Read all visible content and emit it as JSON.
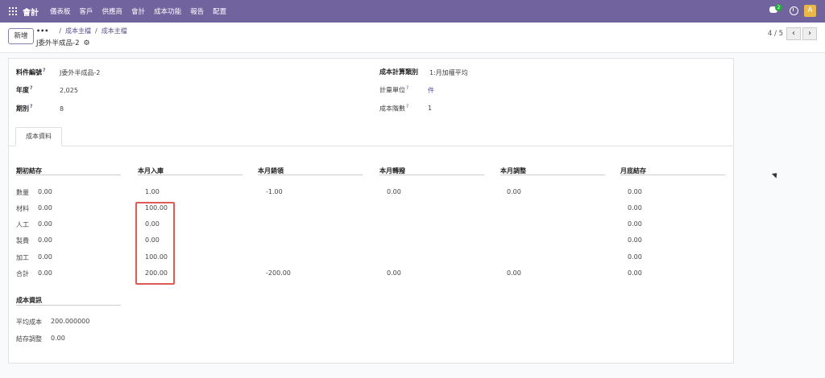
{
  "nav": {
    "brand": "會計",
    "menu": [
      "儀表板",
      "客戶",
      "供應商",
      "會計",
      "成本功能",
      "報告",
      "配置"
    ],
    "chat_count": "2",
    "avatar_letter": "A"
  },
  "control": {
    "new_label": "新增",
    "more": "•••",
    "breadcrumbs": [
      "成本主檔",
      "成本主檔"
    ],
    "record_title": "J委外半成品-2",
    "pager": "4 / 5",
    "prev": "‹",
    "next": "›"
  },
  "form": {
    "item_code_label": "料件編號",
    "item_code": "J委外半成品-2",
    "year_label": "年度",
    "year": "2,025",
    "period_label": "期別",
    "period": "8",
    "calc_type_label": "成本計算類別",
    "calc_type": "1:月加權平均",
    "uom_label": "計量單位",
    "uom": "件",
    "cost_level_label": "成本階數",
    "cost_level": "1",
    "help_mark": "?"
  },
  "tab": {
    "label": "成本資料"
  },
  "cost_table": {
    "columns": [
      "期初結存",
      "本月入庫",
      "本月銷領",
      "本月轉撥",
      "本月調整",
      "月底結存"
    ],
    "rows": [
      {
        "label": "數量",
        "values": [
          "0.00",
          "1.00",
          "-1.00",
          "0.00",
          "0.00",
          "0.00"
        ]
      },
      {
        "label": "材料",
        "values": [
          "0.00",
          "100.00",
          "",
          "",
          "",
          "0.00"
        ]
      },
      {
        "label": "人工",
        "values": [
          "0.00",
          "0.00",
          "",
          "",
          "",
          "0.00"
        ]
      },
      {
        "label": "製費",
        "values": [
          "0.00",
          "0.00",
          "",
          "",
          "",
          "0.00"
        ]
      },
      {
        "label": "加工",
        "values": [
          "0.00",
          "100.00",
          "",
          "",
          "",
          "0.00"
        ]
      },
      {
        "label": "合計",
        "values": [
          "0.00",
          "200.00",
          "-200.00",
          "0.00",
          "0.00",
          "0.00"
        ]
      }
    ]
  },
  "cost_info": {
    "title": "成本資訊",
    "avg_cost_label": "平均成本",
    "avg_cost": "200.000000",
    "adjust_label": "結存調整",
    "adjust": "0.00"
  }
}
